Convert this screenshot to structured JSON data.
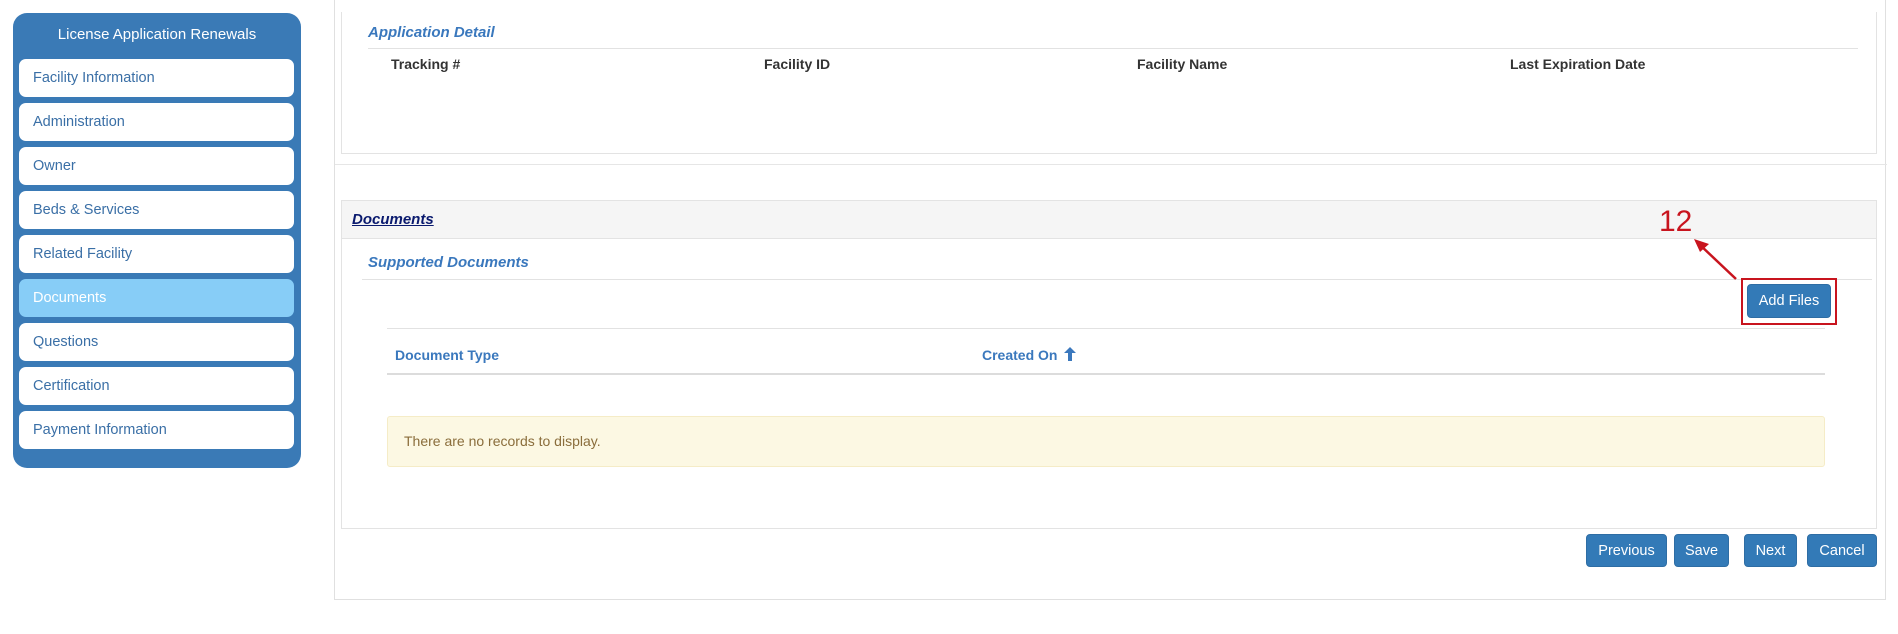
{
  "sidebar": {
    "title": "License Application Renewals",
    "items": [
      {
        "label": "Facility Information"
      },
      {
        "label": "Administration"
      },
      {
        "label": "Owner"
      },
      {
        "label": "Beds & Services"
      },
      {
        "label": "Related Facility"
      },
      {
        "label": "Documents",
        "active": true
      },
      {
        "label": "Questions"
      },
      {
        "label": "Certification"
      },
      {
        "label": "Payment Information"
      }
    ]
  },
  "application_detail": {
    "title": "Application Detail",
    "columns": [
      "Tracking #",
      "Facility ID",
      "Facility Name",
      "Last Expiration Date"
    ]
  },
  "documents": {
    "header_link": "Documents",
    "subtitle": "Supported Documents",
    "add_files_label": "Add Files",
    "table_columns": [
      "Document Type",
      "Created On"
    ],
    "sort_icon": "arrow-up-icon",
    "empty_message": "There are no records to display."
  },
  "footer_buttons": {
    "previous": "Previous",
    "save": "Save",
    "next": "Next",
    "cancel": "Cancel"
  },
  "annotation": {
    "number": "12",
    "color": "#c8141e"
  },
  "colors": {
    "sidebar_bg": "#3a7ab6",
    "active_item": "#87cdf7",
    "button": "#337ab7",
    "section_title": "#3a78bd"
  }
}
